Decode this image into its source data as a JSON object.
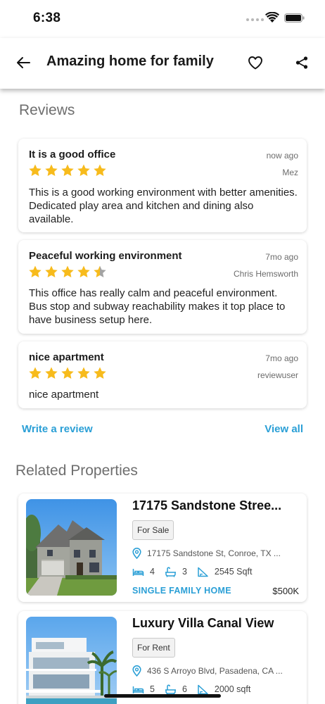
{
  "status_bar": {
    "time": "6:38"
  },
  "app_bar": {
    "title": "Amazing home for family"
  },
  "reviews": {
    "section_title": "Reviews",
    "items": [
      {
        "title": "It is a good office",
        "time": "now ago",
        "user": "Mez",
        "rating": 5,
        "body": "This is a good working environment with better amenities. Dedicated play area and kitchen and dining also available."
      },
      {
        "title": "Peaceful working environment",
        "time": "7mo ago",
        "user": "Chris Hemsworth",
        "rating": 4.5,
        "body": "This office has really calm and peaceful environment. Bus stop and subway reachability makes it top place to have business setup here."
      },
      {
        "title": "nice apartment",
        "time": "7mo ago",
        "user": "reviewuser",
        "rating": 5,
        "body": "nice apartment"
      }
    ],
    "write_review_label": "Write a review",
    "view_all_label": "View all"
  },
  "related": {
    "section_title": "Related Properties",
    "items": [
      {
        "title": "17175 Sandstone Stree...",
        "status": "For Sale",
        "address": "17175 Sandstone St, Conroe, TX ...",
        "beds": "4",
        "baths": "3",
        "area": "2545 Sqft",
        "type": "SINGLE FAMILY HOME",
        "price": "$500K"
      },
      {
        "title": "Luxury Villa Canal View",
        "status": "For Rent",
        "address": "436 S Arroyo Blvd, Pasadena, CA ...",
        "beds": "5",
        "baths": "6",
        "area": "2000 sqft",
        "type": "",
        "price": ""
      }
    ]
  },
  "colors": {
    "accent": "#2a9fd6",
    "star": "#f7bb1c",
    "star_empty": "#a3a3a3"
  }
}
